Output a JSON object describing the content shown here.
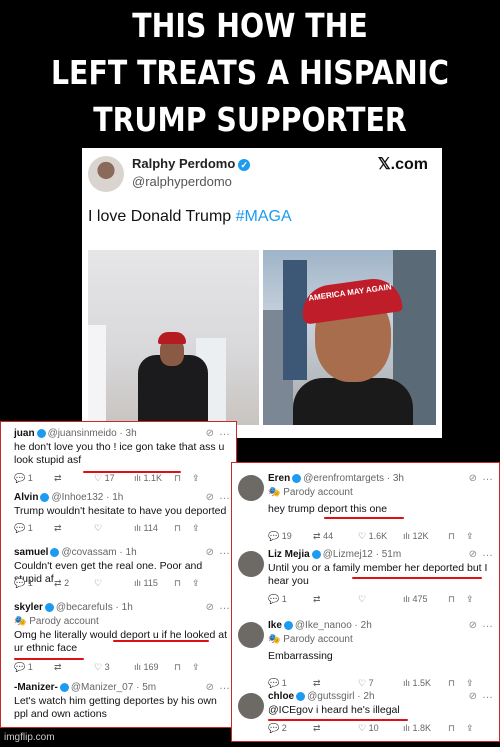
{
  "headline": {
    "line1": "THIS HOW THE",
    "line2": "LEFT TREATS  A HISPANIC",
    "line3": "TRUMP SUPPORTER"
  },
  "main_tweet": {
    "name": "Ralphy Perdomo",
    "handle": "@ralphyperdomo",
    "site": "𝕏.com",
    "text_prefix": "I love Donald Trump ",
    "hashtag": "#MAGA",
    "cap_text": "AMERICA MAY AGAIN"
  },
  "left_replies": [
    {
      "name": "juan",
      "handle": "@juansinmeido · 3h",
      "parody": "",
      "body": "he don't love you tho ! ice gon take that ass u look stupid asf",
      "replies": "1",
      "retweets": "",
      "likes": "17",
      "views": "1.1K"
    },
    {
      "name": "Alvin",
      "handle": "@Inhoe132 · 1h",
      "parody": "",
      "body": "Trump wouldn't hesitate to have you deported",
      "replies": "1",
      "retweets": "",
      "likes": "",
      "views": "114"
    },
    {
      "name": "samuel",
      "handle": "@covassam · 1h",
      "parody": "",
      "body": "Couldn't even get the real one. Poor and stupid af",
      "replies": "1",
      "retweets": "2",
      "likes": "",
      "views": "115"
    },
    {
      "name": "skyler",
      "handle": "@becarefuIs · 1h",
      "parody": "Parody account",
      "body": "Omg he literally would deport u if he looked at ur ethnic face",
      "replies": "1",
      "retweets": "",
      "likes": "3",
      "views": "169"
    },
    {
      "name": "-Manizer-",
      "handle": "@Manizer_07 · 5m",
      "parody": "",
      "body": "Let's watch him getting deportes by his own ppl and own actions",
      "replies": "",
      "retweets": "",
      "likes": "",
      "views": ""
    }
  ],
  "right_replies": [
    {
      "name": "Eren",
      "handle": "@erenfromtargets · 3h",
      "parody": "Parody account",
      "body": "hey trump deport this one",
      "replies": "19",
      "retweets": "44",
      "likes": "1.6K",
      "views": "12K"
    },
    {
      "name": "Liz Mejia",
      "handle": "@Lizmej12 · 51m",
      "parody": "",
      "body": "Until you or a family member her deported but I hear you",
      "replies": "1",
      "retweets": "",
      "likes": "",
      "views": "475"
    },
    {
      "name": "Ike",
      "handle": "@Ike_nanoo · 2h",
      "parody": "Parody account",
      "body": "Embarrassing",
      "replies": "1",
      "retweets": "",
      "likes": "7",
      "views": "1.5K"
    },
    {
      "name": "chloe",
      "handle": "@gutssgirl · 2h",
      "parody": "",
      "body": "@ICEgov i heard he's illegal",
      "replies": "2",
      "retweets": "",
      "likes": "10",
      "views": "1.8K"
    }
  ],
  "icons": {
    "reply": "reply-icon",
    "retweet": "retweet-icon",
    "like": "heart-icon",
    "views": "views-icon"
  },
  "footer": "imgflip.com"
}
